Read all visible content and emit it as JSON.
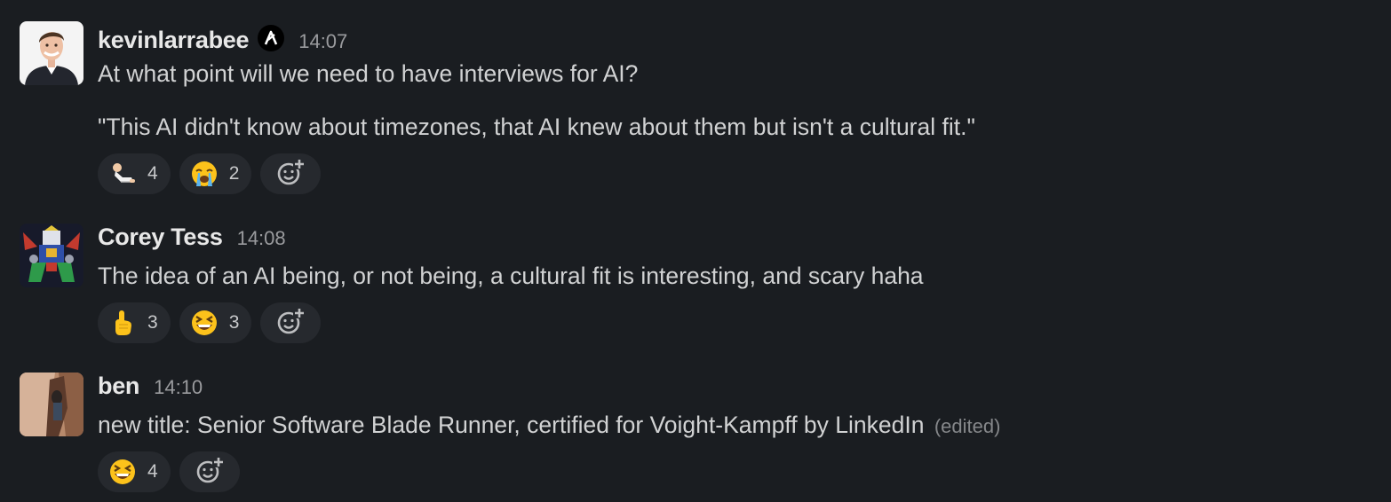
{
  "messages": [
    {
      "username": "kevinlarrabee",
      "badge_icon": "product-logo-badge-icon",
      "timestamp": "14:07",
      "lines": [
        "At what point will we need to have interviews for AI?",
        "\"This AI didn't know about timezones, that AI knew about them but isn't a cultural fit.\""
      ],
      "reactions": [
        {
          "emoji": "person-lying-down-icon",
          "count": "4"
        },
        {
          "emoji": "loudly-crying-face-icon",
          "count": "2"
        }
      ]
    },
    {
      "username": "Corey Tess",
      "timestamp": "14:08",
      "lines": [
        "The idea of an AI being, or not being, a cultural fit is interesting, and scary haha"
      ],
      "reactions": [
        {
          "emoji": "index-pointing-up-icon",
          "count": "3"
        },
        {
          "emoji": "grinning-squinting-face-icon",
          "count": "3"
        }
      ]
    },
    {
      "username": "ben",
      "timestamp": "14:10",
      "lines": [
        "new title: Senior Software Blade Runner, certified for Voight-Kampff by LinkedIn"
      ],
      "edited_label": "(edited)",
      "reactions": [
        {
          "emoji": "grinning-squinting-face-icon",
          "count": "4"
        }
      ]
    }
  ],
  "colors": {
    "background": "#1a1d21",
    "reaction_pill": "#26292e",
    "username": "#e8e8e8",
    "text": "#d1d2d3",
    "muted": "#9a9b9e"
  }
}
